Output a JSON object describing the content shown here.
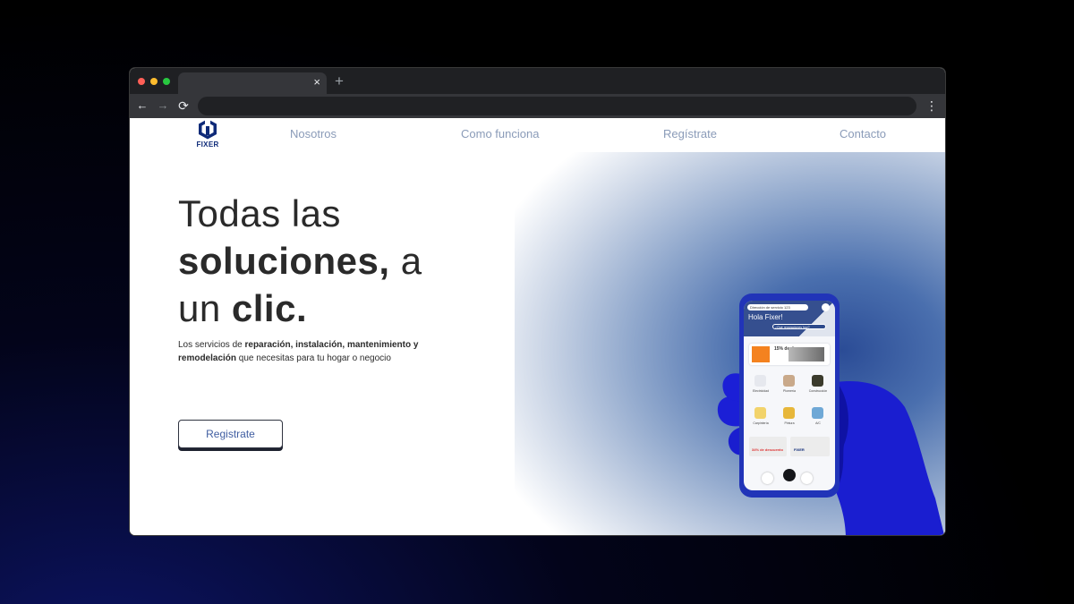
{
  "browser": {
    "tab_close_symbol": "×",
    "new_tab_symbol": "+",
    "back_symbol": "←",
    "forward_symbol": "→",
    "reload_symbol": "⟳",
    "menu_symbol": "⋮",
    "address_value": ""
  },
  "site": {
    "logo_text": "FIXER",
    "nav": [
      "Nosotros",
      "Como funciona",
      "Regístrate",
      "Contacto"
    ],
    "colors": {
      "brand": "#0e2a78",
      "nav_text": "#8a9bb8",
      "cta_text": "#3f5da1"
    }
  },
  "hero": {
    "title_line1": "Todas las",
    "title_bold1": "soluciones,",
    "title_line2_rest": " a",
    "title_line3_pre": "un ",
    "title_bold2": "clic.",
    "desc_1": "Los servicios de ",
    "desc_b1": "reparación, instalación, mantenimiento y remodelación",
    "desc_2": " que necesitas para tu hogar o negocio",
    "cta_label": "Registrate"
  },
  "phone_app": {
    "address": "Dirección de servicio 123",
    "greeting": "Hola Fixer!",
    "search_placeholder": "¿Qué reparaciones hoy?",
    "banner_pct": "15% de desc.",
    "categories": [
      "Electricidad",
      "Plomería",
      "Construcción",
      "Carpintería",
      "Pintura",
      "A/C"
    ],
    "promo_1": "34% de descuento",
    "promo_2": "FIXER"
  }
}
